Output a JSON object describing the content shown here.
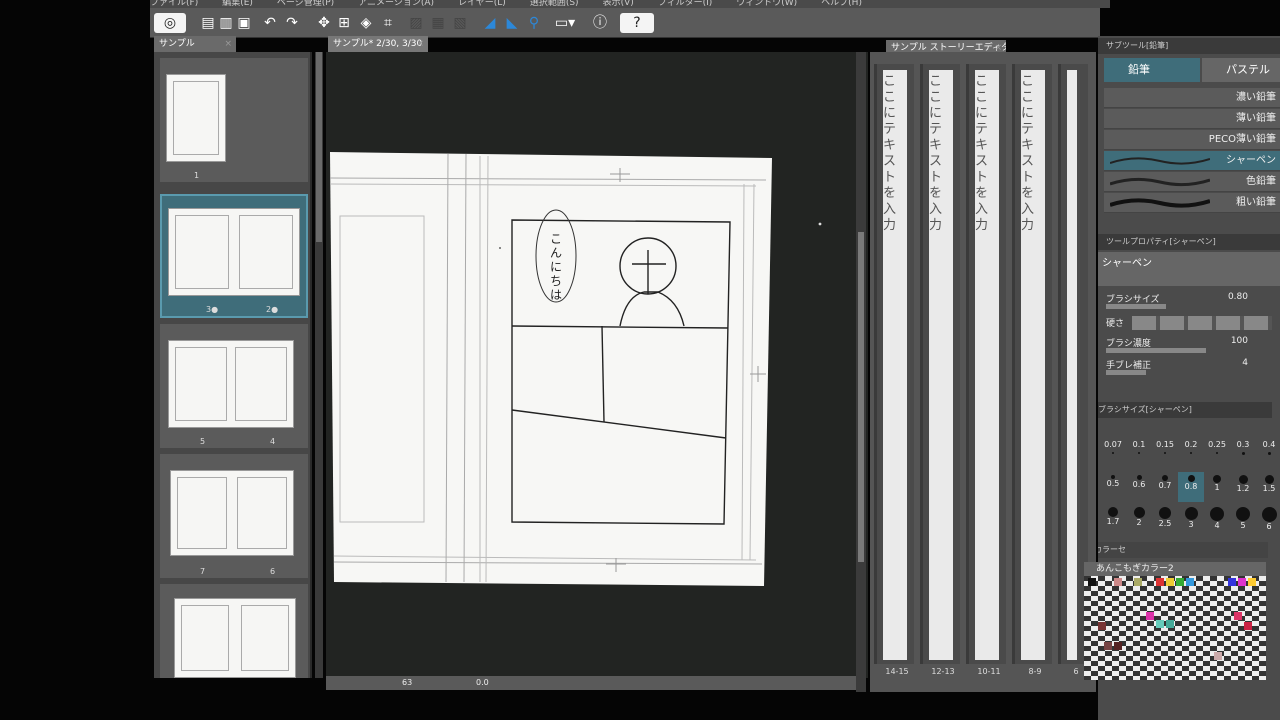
{
  "menu": [
    "ファイル(F)",
    "編集(E)",
    "ページ管理(P)",
    "アニメーション(A)",
    "レイヤー(L)",
    "選択範囲(S)",
    "表示(V)",
    "フィルター(I)",
    "ウィンドウ(W)",
    "ヘルプ(H)"
  ],
  "tabs": {
    "left": "サンプル",
    "canvas": "サンプル* 2/30, 3/30",
    "story": "サンプル ストーリーエディター",
    "subtool": "サブツール[鉛筆]",
    "toolprop": "ツールプロパティ[シャーペン]",
    "brushsize": "ブラシサイズ[シャーペン]",
    "color_tab": "カラーセ"
  },
  "thumbnails": [
    {
      "labels": [
        "1"
      ]
    },
    {
      "labels": [
        "3●",
        "2●"
      ]
    },
    {
      "labels": [
        "5",
        "4"
      ]
    },
    {
      "labels": [
        "7",
        "6"
      ]
    },
    {
      "labels": []
    }
  ],
  "canvas": {
    "speech": "こんにちは",
    "zoom": "63",
    "rotation": "0.0"
  },
  "story": {
    "placeholder": "ここにテキストを入力",
    "page_labels": [
      "14-15",
      "12-13",
      "10-11",
      "8-9",
      "6"
    ]
  },
  "subtool": {
    "groups": [
      "鉛筆",
      "パステル"
    ],
    "brushes": [
      "濃い鉛筆",
      "薄い鉛筆",
      "PECO薄い鉛筆",
      "シャーペン",
      "色鉛筆",
      "粗い鉛筆"
    ],
    "selected_brush": "シャーペン"
  },
  "toolprop": {
    "name": "シャーペン",
    "brush_size_label": "ブラシサイズ",
    "brush_size": "0.80",
    "hardness_label": "硬さ",
    "density_label": "ブラシ濃度",
    "density": "100",
    "stabilization_label": "手ブレ補正",
    "stabilization": "4"
  },
  "brush_sizes": [
    "0.07",
    "0.1",
    "0.15",
    "0.2",
    "0.25",
    "0.3",
    "0.4",
    "0.5",
    "0.6",
    "0.7",
    "0.8",
    "1",
    "1.2",
    "1.5",
    "1.7",
    "2",
    "2.5",
    "3",
    "4",
    "5",
    "6"
  ],
  "selected_size": "0.8",
  "palette": {
    "name": "あんこもぎカラー2"
  },
  "colors": {
    "accent": "#3f6d7a",
    "panel": "#4b4b4b",
    "canvas_bg": "#222422"
  }
}
